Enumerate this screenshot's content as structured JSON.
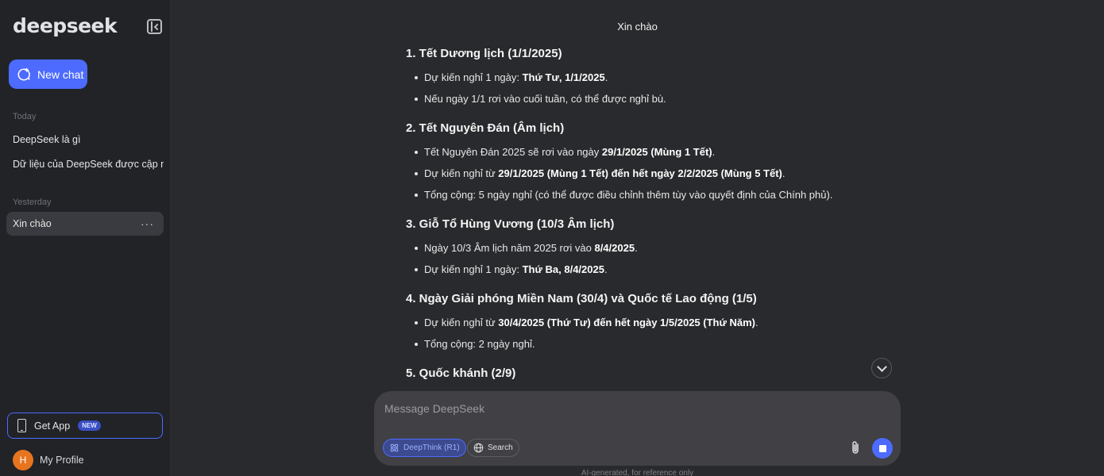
{
  "sidebar": {
    "logo": "deepseek",
    "new_chat_label": "New chat",
    "sections": [
      {
        "label": "Today",
        "items": [
          "DeepSeek là gì",
          "Dữ liệu của DeepSeek được cập nh"
        ]
      },
      {
        "label": "Yesterday",
        "items": [
          "Xin chào"
        ]
      }
    ],
    "active_item_menu": "···",
    "get_app_label": "Get App",
    "get_app_badge": "NEW",
    "profile_initial": "H",
    "profile_label": "My Profile"
  },
  "chat": {
    "title": "Xin chào",
    "sections": [
      {
        "heading": "1. Tết Dương lịch (1/1/2025)",
        "items": [
          [
            {
              "t": "Dự kiến nghỉ 1 ngày: "
            },
            {
              "t": "Thứ Tư, 1/1/2025",
              "b": true
            },
            {
              "t": "."
            }
          ],
          [
            {
              "t": "Nếu ngày 1/1 rơi vào cuối tuần, có thể được nghỉ bù."
            }
          ]
        ]
      },
      {
        "heading": "2. Tết Nguyên Đán (Âm lịch)",
        "items": [
          [
            {
              "t": "Tết Nguyên Đán 2025 sẽ rơi vào ngày "
            },
            {
              "t": "29/1/2025 (Mùng 1 Tết)",
              "b": true
            },
            {
              "t": "."
            }
          ],
          [
            {
              "t": "Dự kiến nghỉ từ "
            },
            {
              "t": "29/1/2025 (Mùng 1 Tết) đến hết ngày 2/2/2025 (Mùng 5 Tết)",
              "b": true
            },
            {
              "t": "."
            }
          ],
          [
            {
              "t": "Tổng cộng: 5 ngày nghỉ (có thể được điều chỉnh thêm tùy vào quyết định của Chính phủ)."
            }
          ]
        ]
      },
      {
        "heading": "3. Giỗ Tổ Hùng Vương (10/3 Âm lịch)",
        "items": [
          [
            {
              "t": "Ngày 10/3 Âm lịch năm 2025 rơi vào "
            },
            {
              "t": "8/4/2025",
              "b": true
            },
            {
              "t": "."
            }
          ],
          [
            {
              "t": "Dự kiến nghỉ 1 ngày: "
            },
            {
              "t": "Thứ Ba, 8/4/2025",
              "b": true
            },
            {
              "t": "."
            }
          ]
        ]
      },
      {
        "heading": "4. Ngày Giải phóng Miền Nam (30/4) và Quốc tế Lao động (1/5)",
        "items": [
          [
            {
              "t": "Dự kiến nghỉ từ "
            },
            {
              "t": "30/4/2025 (Thứ Tư) đến hết ngày 1/5/2025 (Thứ Năm)",
              "b": true
            },
            {
              "t": "."
            }
          ],
          [
            {
              "t": "Tổng cộng: 2 ngày nghỉ."
            }
          ]
        ]
      },
      {
        "heading": "5. Quốc khánh (2/9)",
        "items": []
      }
    ]
  },
  "composer": {
    "placeholder": "Message DeepSeek",
    "deepthink_label": "DeepThink (R1)",
    "search_label": "Search"
  },
  "footer_note": "AI-generated, for reference only",
  "colors": {
    "accent": "#4d6bfe",
    "sidebar_bg": "#212327",
    "main_bg": "#292a2d",
    "composer_bg": "#404045",
    "avatar": "#e8741f"
  }
}
